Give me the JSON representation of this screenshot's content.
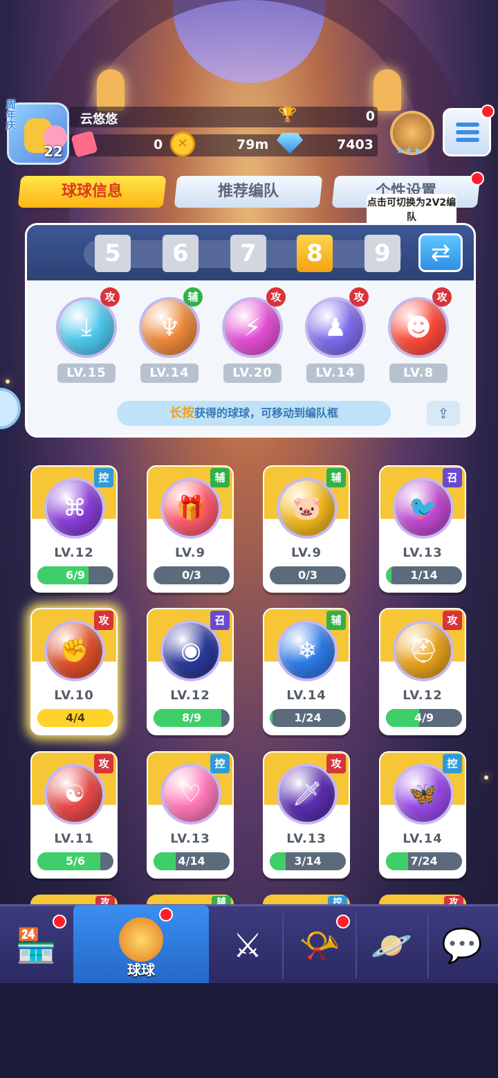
{
  "player": {
    "anniversary": "周年庆",
    "level": "22",
    "name": "云悠悠",
    "trophies": "0",
    "tickets": "0",
    "distance": "79m",
    "diamonds": "7403"
  },
  "tabs": [
    {
      "label": "球球信息",
      "active": true
    },
    {
      "label": "推荐编队",
      "active": false
    },
    {
      "label": "个性设置",
      "active": false
    }
  ],
  "tip": "点击可切换为2V2编队",
  "team": {
    "slots": [
      "5",
      "6",
      "7",
      "8",
      "9"
    ],
    "active_slot": "8",
    "balls": [
      {
        "role": "攻",
        "level": "LV.15",
        "color": "#4fc9ef",
        "icon": "⤓"
      },
      {
        "role": "辅",
        "level": "LV.14",
        "color": "#f08a3a",
        "icon": "♆"
      },
      {
        "role": "攻",
        "level": "LV.20",
        "color": "#e64fd6",
        "icon": "⚡"
      },
      {
        "role": "攻",
        "level": "LV.14",
        "color": "#7f6ef0",
        "icon": "♟"
      },
      {
        "role": "攻",
        "level": "LV.8",
        "color": "#ff4a3a",
        "icon": "☻"
      }
    ],
    "hint_highlight": "长按",
    "hint_text": "获得的球球，可移动到编队框"
  },
  "cards": [
    {
      "role": "控",
      "level": "LV.12",
      "progress": "6/9",
      "ratio": 0.67,
      "color": "#8a3ed8",
      "icon": "⌘"
    },
    {
      "role": "辅",
      "level": "LV.9",
      "progress": "0/3",
      "ratio": 0,
      "color": "#ff5a6c",
      "icon": "🎁"
    },
    {
      "role": "辅",
      "level": "LV.9",
      "progress": "0/3",
      "ratio": 0,
      "color": "#f2b81c",
      "icon": "🐷"
    },
    {
      "role": "召",
      "level": "LV.13",
      "progress": "1/14",
      "ratio": 0.07,
      "color": "#c04ad0",
      "icon": "🐦"
    },
    {
      "role": "攻",
      "level": "LV.10",
      "progress": "4/4",
      "ratio": 1,
      "color": "#e0502a",
      "icon": "✊",
      "glow": true
    },
    {
      "role": "召",
      "level": "LV.12",
      "progress": "8/9",
      "ratio": 0.89,
      "color": "#2b3a9a",
      "icon": "◉"
    },
    {
      "role": "辅",
      "level": "LV.14",
      "progress": "1/24",
      "ratio": 0.04,
      "color": "#2f7ae8",
      "icon": "❄"
    },
    {
      "role": "攻",
      "level": "LV.12",
      "progress": "4/9",
      "ratio": 0.44,
      "color": "#e8a21c",
      "icon": "⛑"
    },
    {
      "role": "攻",
      "level": "LV.11",
      "progress": "5/6",
      "ratio": 0.83,
      "color": "#e84a4a",
      "icon": "☯"
    },
    {
      "role": "控",
      "level": "LV.13",
      "progress": "4/14",
      "ratio": 0.29,
      "color": "#ff77b8",
      "icon": "♡"
    },
    {
      "role": "攻",
      "level": "LV.13",
      "progress": "3/14",
      "ratio": 0.21,
      "color": "#5a2eb0",
      "icon": "🗡"
    },
    {
      "role": "控",
      "level": "LV.14",
      "progress": "7/24",
      "ratio": 0.29,
      "color": "#9a4ae8",
      "icon": "🦋"
    }
  ],
  "peek_roles": [
    "攻",
    "辅",
    "控",
    "攻"
  ],
  "nav": {
    "items": [
      {
        "name": "shop",
        "icon": "🏪"
      },
      {
        "name": "balls",
        "label": "球球",
        "active": true
      },
      {
        "name": "battle",
        "icon": "⚔"
      },
      {
        "name": "whistle",
        "icon": "📯"
      },
      {
        "name": "planet",
        "icon": "🪐"
      },
      {
        "name": "chat",
        "icon": "💬"
      }
    ]
  }
}
